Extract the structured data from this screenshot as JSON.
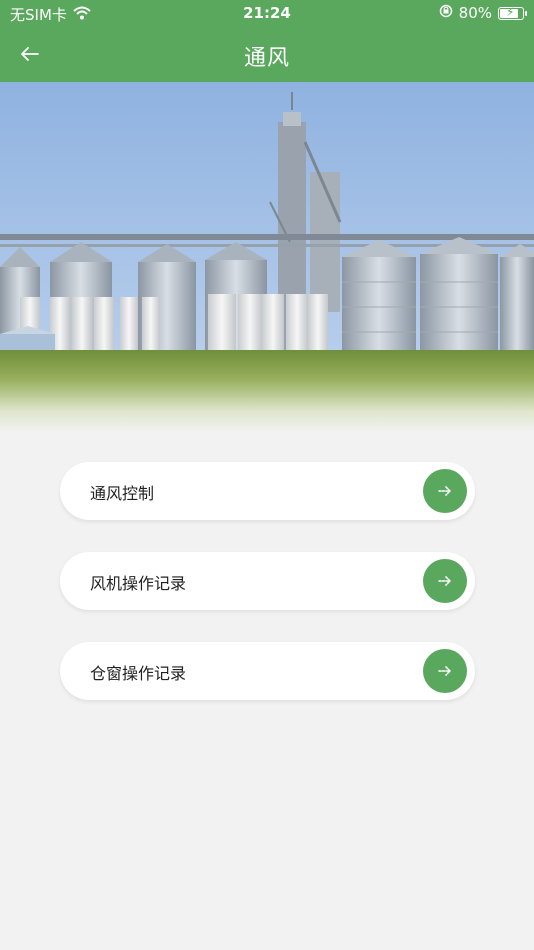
{
  "status_bar": {
    "carrier": "无SIM卡",
    "time": "21:24",
    "battery_percent": "80%",
    "icons": [
      "wifi-icon",
      "orientation-lock-icon",
      "battery-icon"
    ]
  },
  "nav": {
    "title": "通风",
    "back_icon": "arrow-left-icon"
  },
  "menu": {
    "items": [
      {
        "label": "通风控制",
        "icon": "arrow-right-icon"
      },
      {
        "label": "风机操作记录",
        "icon": "arrow-right-icon"
      },
      {
        "label": "仓窗操作记录",
        "icon": "arrow-right-icon"
      }
    ]
  },
  "colors": {
    "primary": "#5aa85d",
    "background": "#f2f2f2",
    "card": "#ffffff"
  }
}
